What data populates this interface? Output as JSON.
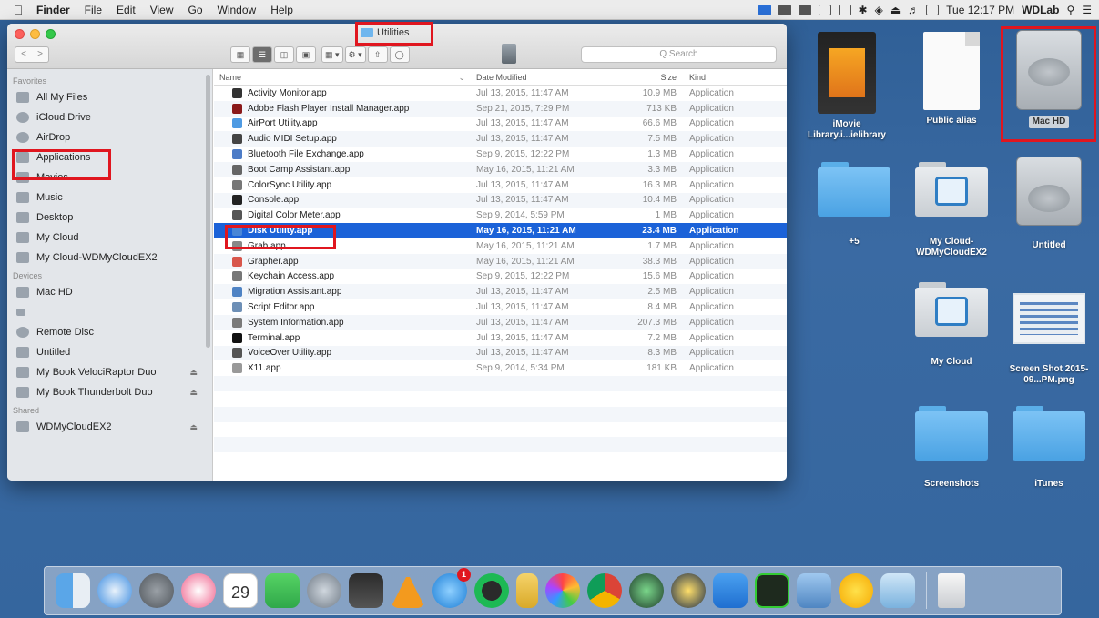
{
  "menubar": {
    "apple": "",
    "items": [
      "Finder",
      "File",
      "Edit",
      "View",
      "Go",
      "Window",
      "Help"
    ],
    "clock": "Tue 12:17 PM",
    "user": "WDLab"
  },
  "window": {
    "title": "Utilities",
    "search_placeholder": "Q Search",
    "nav_back": "<",
    "nav_forward": ">"
  },
  "sidebar": {
    "favorites_header": "Favorites",
    "favorites": [
      "All My Files",
      "iCloud Drive",
      "AirDrop",
      "Applications",
      "Movies",
      "Music",
      "Desktop",
      "My Cloud",
      "My Cloud-WDMyCloudEX2"
    ],
    "devices_header": "Devices",
    "devices": [
      "Mac HD",
      "Remote Disc",
      "Untitled",
      "My Book VelociRaptor Duo",
      "My Book Thunderbolt Duo"
    ],
    "shared_header": "Shared",
    "shared": [
      "WDMyCloudEX2"
    ]
  },
  "list": {
    "headers": {
      "name": "Name",
      "date": "Date Modified",
      "size": "Size",
      "kind": "Kind"
    },
    "rows": [
      {
        "name": "Activity Monitor.app",
        "date": "Jul 13, 2015, 11:47 AM",
        "size": "10.9 MB",
        "kind": "Application"
      },
      {
        "name": "Adobe Flash Player Install Manager.app",
        "date": "Sep 21, 2015, 7:29 PM",
        "size": "713 KB",
        "kind": "Application"
      },
      {
        "name": "AirPort Utility.app",
        "date": "Jul 13, 2015, 11:47 AM",
        "size": "66.6 MB",
        "kind": "Application"
      },
      {
        "name": "Audio MIDI Setup.app",
        "date": "Jul 13, 2015, 11:47 AM",
        "size": "7.5 MB",
        "kind": "Application"
      },
      {
        "name": "Bluetooth File Exchange.app",
        "date": "Sep 9, 2015, 12:22 PM",
        "size": "1.3 MB",
        "kind": "Application"
      },
      {
        "name": "Boot Camp Assistant.app",
        "date": "May 16, 2015, 11:21 AM",
        "size": "3.3 MB",
        "kind": "Application"
      },
      {
        "name": "ColorSync Utility.app",
        "date": "Jul 13, 2015, 11:47 AM",
        "size": "16.3 MB",
        "kind": "Application"
      },
      {
        "name": "Console.app",
        "date": "Jul 13, 2015, 11:47 AM",
        "size": "10.4 MB",
        "kind": "Application"
      },
      {
        "name": "Digital Color Meter.app",
        "date": "Sep 9, 2014, 5:59 PM",
        "size": "1 MB",
        "kind": "Application"
      },
      {
        "name": "Disk Utility.app",
        "date": "May 16, 2015, 11:21 AM",
        "size": "23.4 MB",
        "kind": "Application",
        "selected": true
      },
      {
        "name": "Grab.app",
        "date": "May 16, 2015, 11:21 AM",
        "size": "1.7 MB",
        "kind": "Application"
      },
      {
        "name": "Grapher.app",
        "date": "May 16, 2015, 11:21 AM",
        "size": "38.3 MB",
        "kind": "Application"
      },
      {
        "name": "Keychain Access.app",
        "date": "Sep 9, 2015, 12:22 PM",
        "size": "15.6 MB",
        "kind": "Application"
      },
      {
        "name": "Migration Assistant.app",
        "date": "Jul 13, 2015, 11:47 AM",
        "size": "2.5 MB",
        "kind": "Application"
      },
      {
        "name": "Script Editor.app",
        "date": "Jul 13, 2015, 11:47 AM",
        "size": "8.4 MB",
        "kind": "Application"
      },
      {
        "name": "System Information.app",
        "date": "Jul 13, 2015, 11:47 AM",
        "size": "207.3 MB",
        "kind": "Application"
      },
      {
        "name": "Terminal.app",
        "date": "Jul 13, 2015, 11:47 AM",
        "size": "7.2 MB",
        "kind": "Application"
      },
      {
        "name": "VoiceOver Utility.app",
        "date": "Jul 13, 2015, 11:47 AM",
        "size": "8.3 MB",
        "kind": "Application"
      },
      {
        "name": "X11.app",
        "date": "Sep 9, 2014, 5:34 PM",
        "size": "181 KB",
        "kind": "Application"
      }
    ]
  },
  "desktop": {
    "imovie": "iMovie Library.i...ielibrary",
    "public_alias": "Public alias",
    "mac_hd": "Mac HD",
    "folder_plus": "+5",
    "my_cloud_ex2": "My Cloud-WDMyCloudEX2",
    "untitled": "Untitled",
    "my_cloud": "My Cloud",
    "screen_shot": "Screen Shot 2015-09...PM.png",
    "screenshots": "Screenshots",
    "itunes": "iTunes"
  },
  "dock": {
    "calendar_day": "29",
    "appstore_badge": "1"
  },
  "colors": {
    "selection": "#1b62d8",
    "highlight_box": "#e0161f",
    "desktop": "#35669e"
  }
}
